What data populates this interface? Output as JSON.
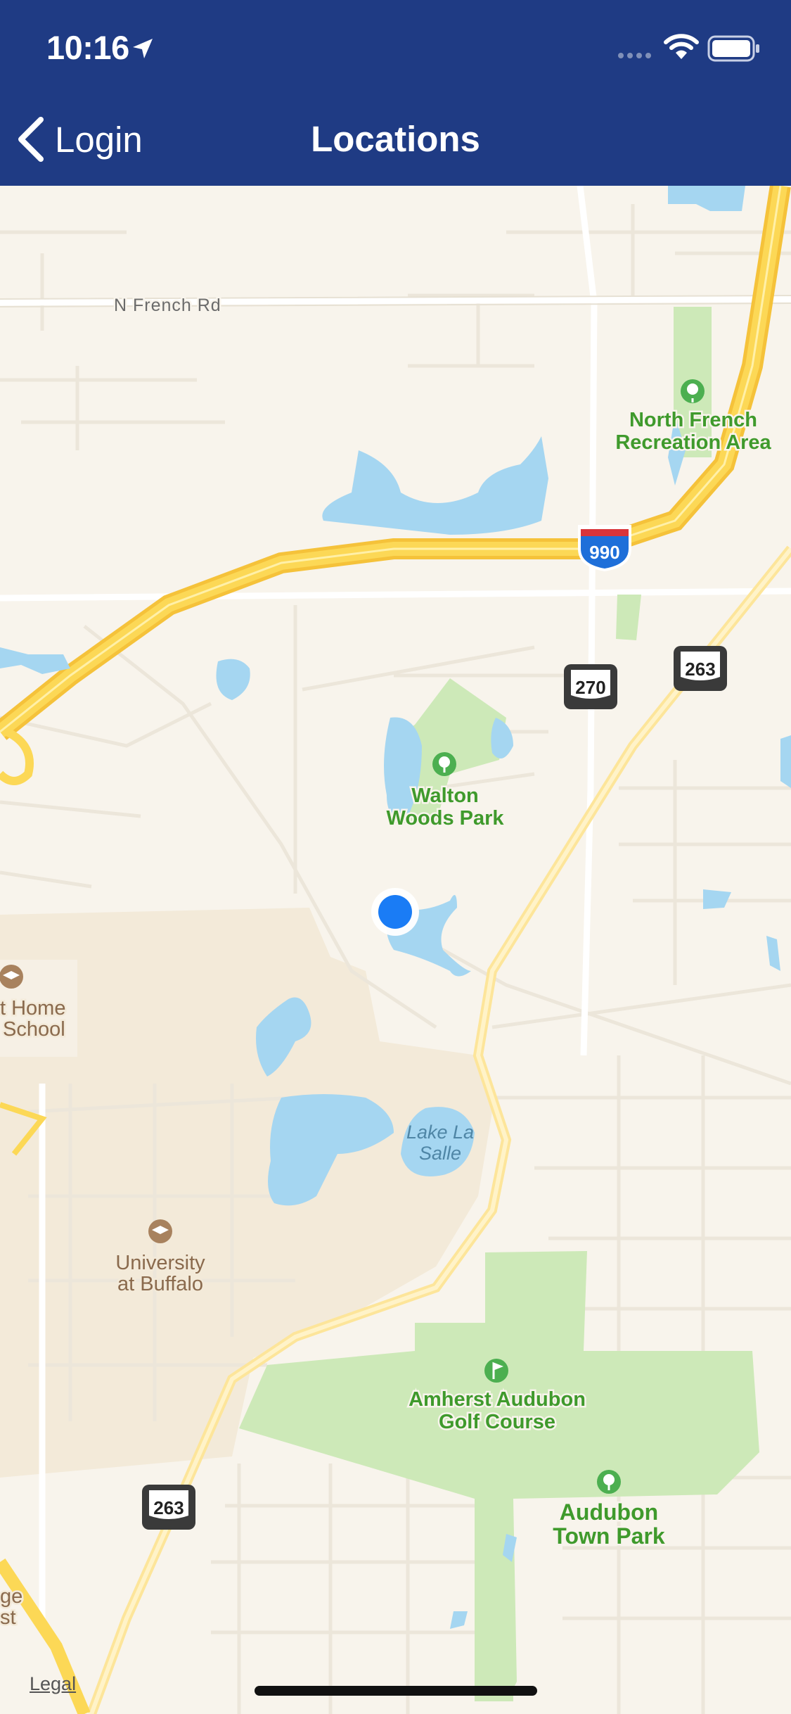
{
  "status_bar": {
    "time": "10:16",
    "icons": [
      "location-arrow-icon",
      "signal-dots-icon",
      "wifi-icon",
      "battery-icon"
    ]
  },
  "nav": {
    "back_label": "Login",
    "title": "Locations",
    "background_color": "#1f3b84"
  },
  "map": {
    "streets": [
      "N French Rd"
    ],
    "highway_shields": [
      {
        "type": "interstate",
        "number": "990"
      },
      {
        "type": "route",
        "number": "270"
      },
      {
        "type": "route",
        "number": "263"
      },
      {
        "type": "route",
        "number": "263"
      }
    ],
    "parks": [
      {
        "lines": [
          "North French",
          "Recreation Area"
        ],
        "icon": "tree-icon"
      },
      {
        "lines": [
          "Walton",
          "Woods Park"
        ],
        "icon": "tree-icon"
      },
      {
        "lines": [
          "Amherst Audubon",
          "Golf Course"
        ],
        "icon": "golf-icon"
      },
      {
        "lines": [
          "Audubon",
          "Town Park"
        ],
        "icon": "tree-icon"
      }
    ],
    "campuses": [
      {
        "lines": [
          "t Home",
          "School"
        ],
        "icon": "graduation-cap-icon"
      },
      {
        "lines": [
          "University",
          "at Buffalo"
        ],
        "icon": "graduation-cap-icon"
      }
    ],
    "water": [
      {
        "lines": [
          "Lake La",
          "Salle"
        ]
      }
    ],
    "edge_labels": [
      "ge",
      "st"
    ],
    "legal": "Legal",
    "colors": {
      "land": "#f8f4ec",
      "park": "#cde9b8",
      "water": "#a5d6f1",
      "campus": "#f3ead9",
      "highway": "#fbd74c",
      "user_location": "#1a7cf5"
    }
  }
}
